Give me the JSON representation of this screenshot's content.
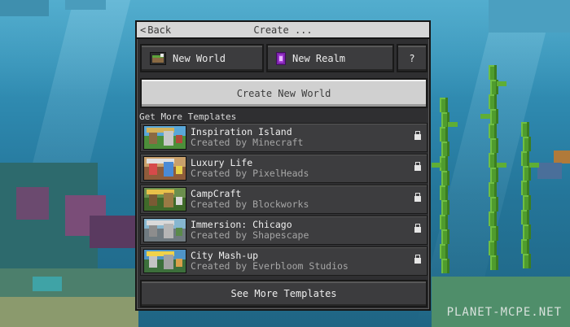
{
  "header": {
    "back_label": "Back",
    "title": "Create ..."
  },
  "tabs": [
    {
      "label": "New World",
      "icon": "world-icon"
    },
    {
      "label": "New Realm",
      "icon": "realm-icon"
    },
    {
      "label": "?",
      "icon": "help-icon"
    }
  ],
  "create_button": {
    "label": "Create New World"
  },
  "templates": {
    "section_label": "Get More Templates",
    "items": [
      {
        "title": "Inspiration Island",
        "creator": "Created by Minecraft",
        "locked": true,
        "thumb_colors": {
          "sky": "#5aa7d8",
          "ground": "#4c8f3a",
          "accent": "#d3b25a"
        }
      },
      {
        "title": "Luxury Life",
        "creator": "Created by PixelHeads",
        "locked": true,
        "thumb_colors": {
          "sky": "#c9a06b",
          "ground": "#8e5c3b",
          "accent": "#e0e0e0"
        }
      },
      {
        "title": "CampCraft",
        "creator": "Created by Blockworks",
        "locked": true,
        "thumb_colors": {
          "sky": "#6b8f4d",
          "ground": "#3f6a2a",
          "accent": "#e8c14a"
        }
      },
      {
        "title": "Immersion: Chicago",
        "creator": "Created by Shapescape",
        "locked": true,
        "thumb_colors": {
          "sky": "#86b6cf",
          "ground": "#6f7a80",
          "accent": "#d9d9d9"
        }
      },
      {
        "title": "City Mash-up",
        "creator": "Created by Everbloom Studios",
        "locked": true,
        "thumb_colors": {
          "sky": "#4f94c6",
          "ground": "#3c6f3b",
          "accent": "#f0d24a"
        }
      }
    ],
    "more_label": "See More Templates"
  },
  "watermark": "PLANET-MCPE.NET",
  "colors": {
    "panel": "#2f2f31",
    "titlebar": "#d6d6d6",
    "water": "#2d87ad",
    "kelp": "#4f9c2e"
  }
}
